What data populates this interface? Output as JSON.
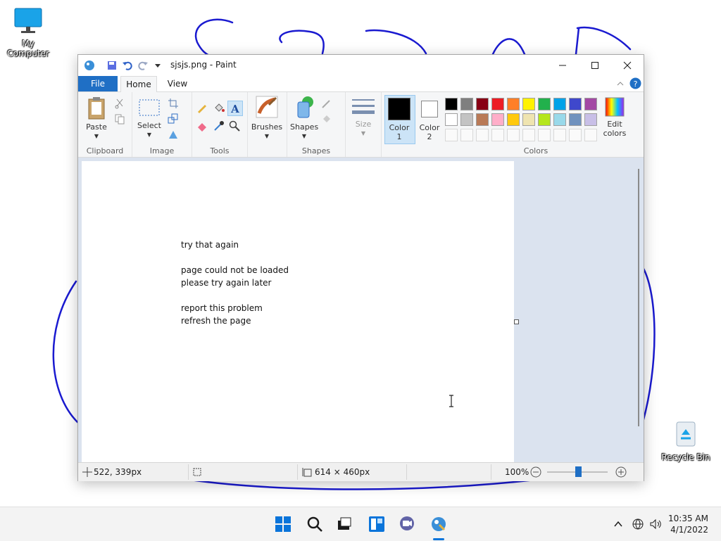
{
  "desktop": {
    "icons": [
      {
        "label": "My Computer"
      },
      {
        "label": "Recycle Bin"
      }
    ]
  },
  "window": {
    "title": "sjsjs.png - Paint",
    "tabs": {
      "file": "File",
      "home": "Home",
      "view": "View"
    },
    "ribbon": {
      "clipboard": {
        "paste": "Paste",
        "group": "Clipboard"
      },
      "image": {
        "select": "Select",
        "group": "Image"
      },
      "tools": {
        "group": "Tools"
      },
      "brushes": {
        "label": "Brushes"
      },
      "shapes": {
        "label": "Shapes",
        "group": "Shapes"
      },
      "size": {
        "label": "Size"
      },
      "color1": {
        "line1": "Color",
        "line2": "1"
      },
      "color2": {
        "line1": "Color",
        "line2": "2"
      },
      "edit_colors": {
        "line1": "Edit",
        "line2": "colors"
      },
      "colors_group": "Colors",
      "palette_row1": [
        "#000000",
        "#7f7f7f",
        "#880015",
        "#ed1c24",
        "#ff7f27",
        "#fff200",
        "#22b14c",
        "#00a2e8",
        "#3f48cc",
        "#a349a4"
      ],
      "palette_row2": [
        "#ffffff",
        "#c3c3c3",
        "#b97a57",
        "#ffaec9",
        "#ffc90e",
        "#efe4b0",
        "#b5e61d",
        "#99d9ea",
        "#7092be",
        "#c8bfe7"
      ]
    },
    "canvas_lines": [
      "try that again",
      "page could not be loaded",
      "please try again later",
      "report this problem",
      "refresh the page"
    ],
    "status": {
      "position": "522, 339px",
      "dimensions": "614 × 460px",
      "zoom": "100%"
    }
  },
  "taskbar": {
    "time": "10:35 AM",
    "date": "4/1/2022"
  }
}
